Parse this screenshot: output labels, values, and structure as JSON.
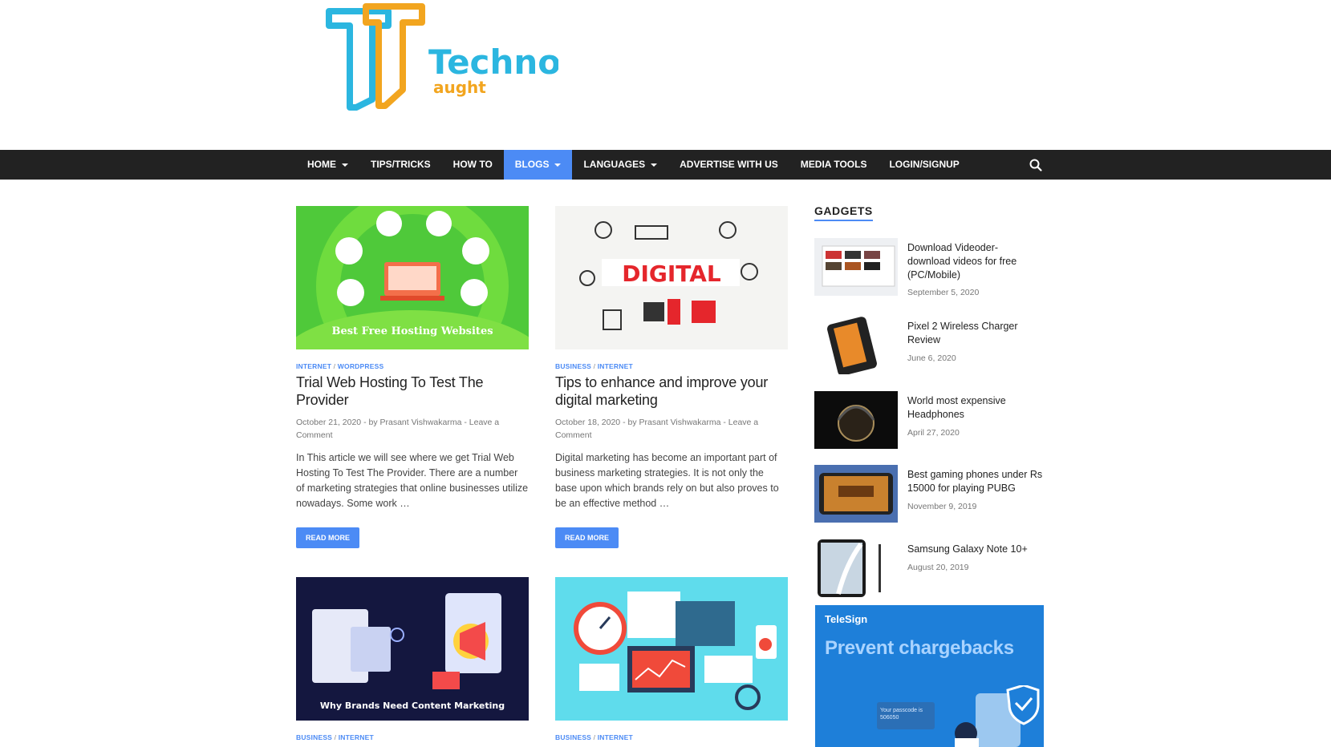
{
  "site": {
    "logo_text_1": "Techno",
    "logo_text_2": "aught"
  },
  "nav": {
    "items": [
      {
        "label": "HOME",
        "dropdown": true
      },
      {
        "label": "TIPS/TRICKS",
        "dropdown": false
      },
      {
        "label": "HOW TO",
        "dropdown": false
      },
      {
        "label": "BLOGS",
        "dropdown": true,
        "active": true
      },
      {
        "label": "LANGUAGES",
        "dropdown": true
      },
      {
        "label": "ADVERTISE WITH US",
        "dropdown": false
      },
      {
        "label": "MEDIA TOOLS",
        "dropdown": false
      },
      {
        "label": "LOGIN/SIGNUP",
        "dropdown": false
      }
    ],
    "search_icon": "search-icon"
  },
  "posts": [
    {
      "cat1": "INTERNET",
      "cat2": "WORDPRESS",
      "title": "Trial Web Hosting To Test The Provider",
      "date": "October 21, 2020",
      "by": "- by",
      "author": "Prasant Vishwakarma",
      "comment": "Leave a Comment",
      "excerpt": "In This article we will see where we get Trial Web Hosting To Test The Provider. There are a number of marketing strategies that online businesses utilize nowadays. Some work …",
      "read_more": "READ MORE",
      "thumb_caption": "Best Free Hosting Websites"
    },
    {
      "cat1": "BUSINESS",
      "cat2": "INTERNET",
      "title": "Tips to enhance and improve your digital marketing",
      "date": "October 18, 2020",
      "by": "- by",
      "author": "Prasant Vishwakarma",
      "comment": "Leave a Comment",
      "excerpt": "Digital marketing has become an important part of business marketing strategies. It is not only the base upon which brands rely on but also proves to be an effective method …",
      "read_more": "READ MORE",
      "thumb_caption": "DIGITAL"
    },
    {
      "cat1": "BUSINESS",
      "cat2": "INTERNET",
      "thumb_caption": "Why Brands Need Content Marketing"
    },
    {
      "cat1": "BUSINESS",
      "cat2": "INTERNET"
    }
  ],
  "sidebar": {
    "title": "GADGETS",
    "items": [
      {
        "title": "Download Videoder- download videos for free (PC/Mobile)",
        "date": "September 5, 2020"
      },
      {
        "title": "Pixel 2 Wireless Charger Review",
        "date": "June 6, 2020"
      },
      {
        "title": "World most expensive Headphones",
        "date": "April 27, 2020"
      },
      {
        "title": "Best gaming phones under Rs 15000 for playing PUBG",
        "date": "November 9, 2019"
      },
      {
        "title": "Samsung Galaxy Note 10+",
        "date": "August 20, 2019"
      }
    ],
    "ad": {
      "brand": "TeleSign",
      "headline": "Prevent chargebacks",
      "code_text": "Your passcode is 506050"
    }
  },
  "colors": {
    "accent": "#4c8bf5",
    "nav_bg": "#222222",
    "logo_blue": "#2bb6e0",
    "logo_orange": "#f2a51f"
  }
}
